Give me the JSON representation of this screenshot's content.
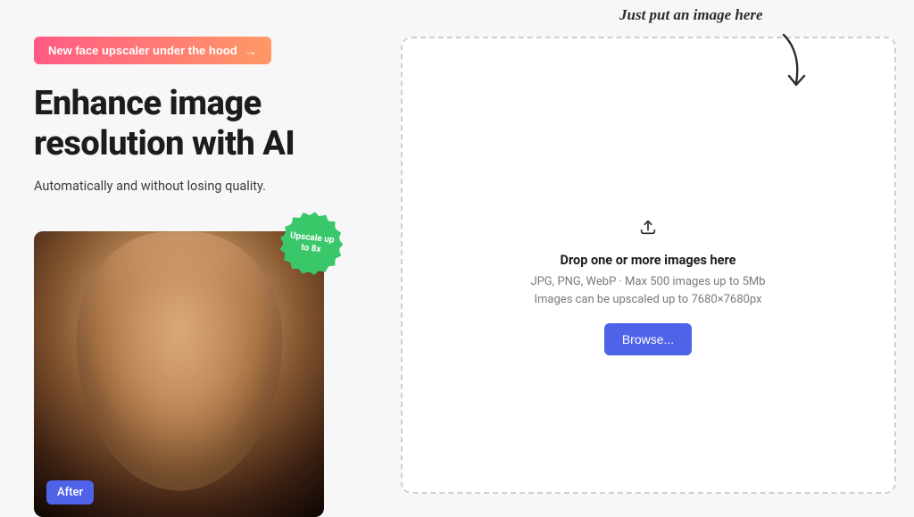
{
  "announcement": {
    "label": "New face upscaler under the hood"
  },
  "hero": {
    "headline": "Enhance image resolution with AI",
    "subtitle": "Automatically and without losing quality."
  },
  "imageCard": {
    "afterLabel": "After",
    "badge": "Upscale up to 8x"
  },
  "dropzone": {
    "handwrittenNote": "Just put an image here",
    "title": "Drop one or more images here",
    "formatsLine": "JPG, PNG, WebP · Max 500 images up to 5Mb",
    "resolutionLine": "Images can be upscaled up to 7680×7680px",
    "browseLabel": "Browse..."
  }
}
